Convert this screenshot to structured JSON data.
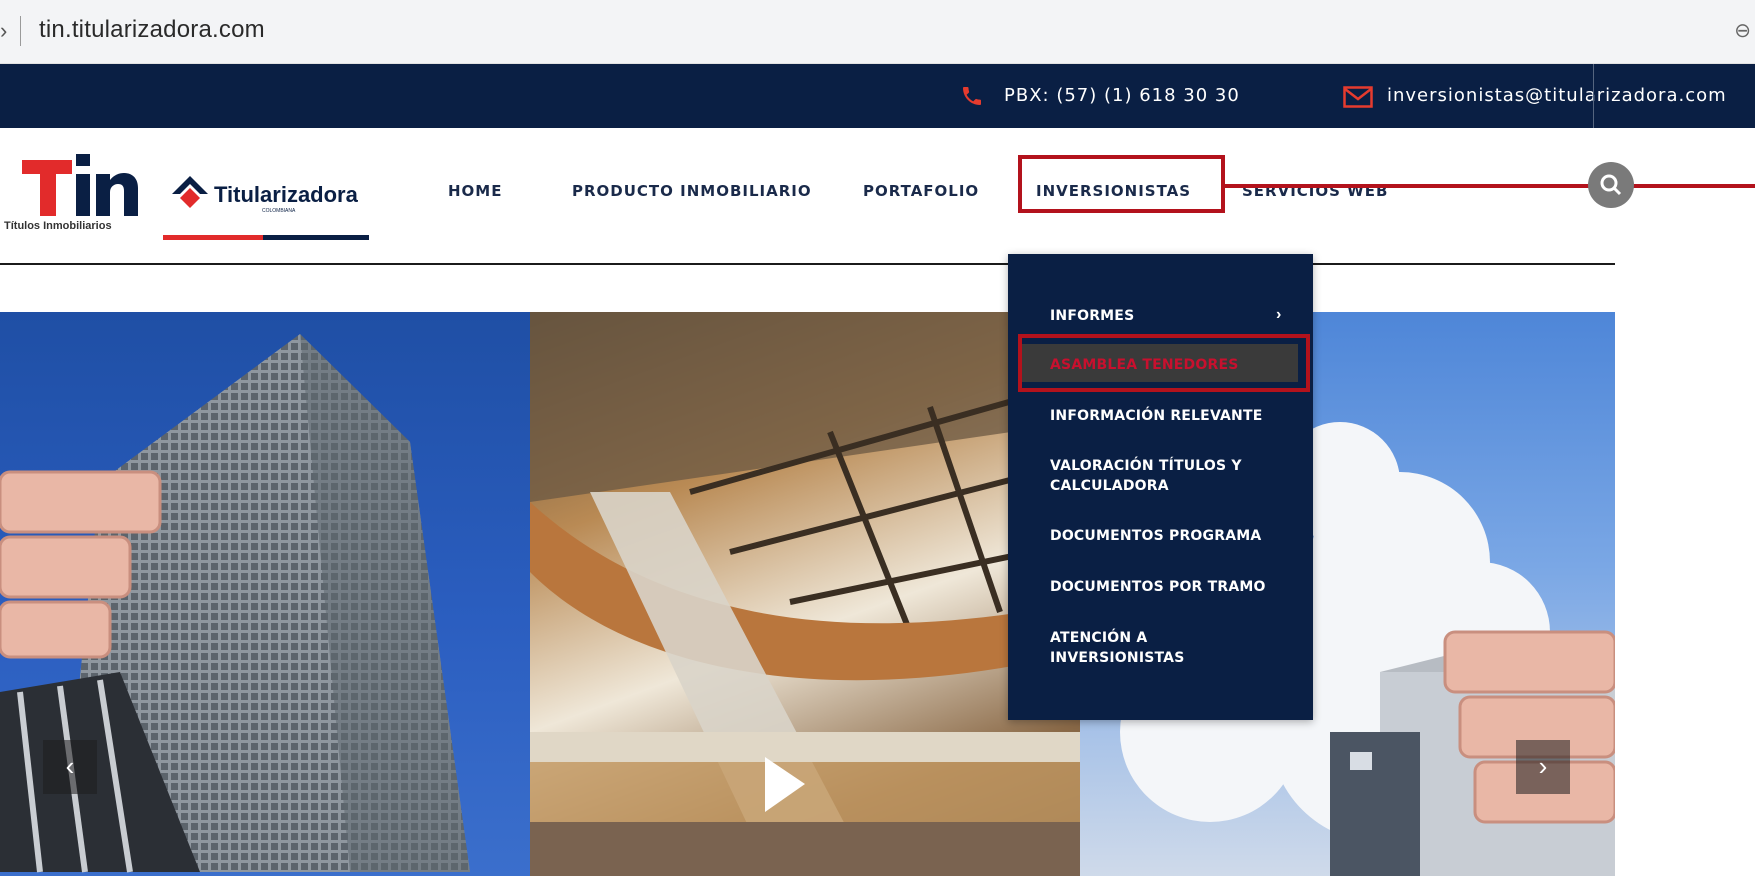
{
  "browser": {
    "url": "tin.titularizadora.com",
    "prefix_glyph": "›",
    "zoom_glyph": "⊖"
  },
  "topbar": {
    "phone": "PBX: (57) (1) 618 30 30",
    "email": "inversionistas@titularizadora.com",
    "accent": "#e63b2e",
    "background": "#0a1f44"
  },
  "logos": {
    "tin_wordmark": "Tin",
    "tin_tagline": "Títulos Inmobiliarios",
    "titularizadora_wordmark": "Titularizadora",
    "titularizadora_sub": "COLOMBIANA"
  },
  "nav": {
    "items": [
      {
        "label": "HOME"
      },
      {
        "label": "PRODUCTO INMOBILIARIO"
      },
      {
        "label": "PORTAFOLIO"
      },
      {
        "label": "INVERSIONISTAS"
      },
      {
        "label": "SERVICIOS WEB"
      }
    ],
    "active": "INVERSIONISTAS"
  },
  "dropdown": {
    "items": [
      {
        "label": "INFORMES",
        "has_submenu": true
      },
      {
        "label": "ASAMBLEA TENEDORES",
        "active": true
      },
      {
        "label": "INFORMACIÓN RELEVANTE"
      },
      {
        "label": "VALORACIÓN TÍTULOS Y CALCULADORA"
      },
      {
        "label": "DOCUMENTOS PROGRAMA"
      },
      {
        "label": "DOCUMENTOS POR TRAMO"
      },
      {
        "label": "ATENCIÓN A INVERSIONISTAS"
      }
    ],
    "chevron": "›"
  },
  "hero": {
    "prev_label": "‹",
    "next_label": "›"
  },
  "colors": {
    "navy": "#0a1f44",
    "highlight_red": "#b3121c",
    "active_text_red": "#c8102e"
  }
}
